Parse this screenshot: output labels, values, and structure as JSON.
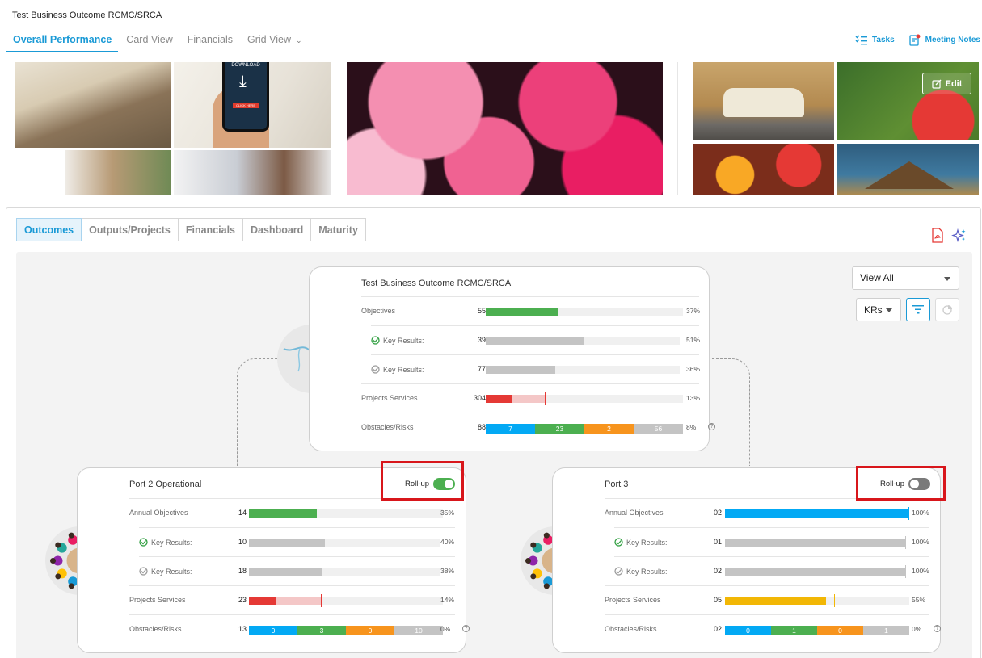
{
  "app": {
    "title": "Test Business Outcome RCMC/SRCA"
  },
  "top_tabs": [
    "Overall Performance",
    "Card View",
    "Financials",
    "Grid View"
  ],
  "header_actions": {
    "tasks": "Tasks",
    "meeting_notes": "Meeting Notes"
  },
  "banner": {
    "edit_label": "Edit",
    "phone_text": "DOWNLOAD",
    "phone_button": "CLICK HERE"
  },
  "sub_tabs": [
    "Outcomes",
    "Outputs/Projects",
    "Financials",
    "Dashboard",
    "Maturity"
  ],
  "controls": {
    "view_select": "View All",
    "kr_select": "KRs"
  },
  "colors": {
    "accent": "#1a9ad6",
    "green": "#4caf50",
    "red": "#e53935",
    "light_red": "#f4c7c7",
    "blue": "#03a9f4",
    "orange": "#f7941d",
    "gray": "#c4c4c4",
    "yellow": "#f2b705",
    "highlight": "#d8161b"
  },
  "cards": {
    "main": {
      "title": "Test Business Outcome RCMC/SRCA",
      "objectives": {
        "label": "Objectives",
        "count": "55",
        "percent": "37%",
        "value": 37
      },
      "kr_done": {
        "label": "Key Results:",
        "count": "39",
        "percent": "51%",
        "value": 51
      },
      "kr_pending": {
        "label": "Key Results:",
        "count": "77",
        "percent": "36%",
        "value": 36
      },
      "projects": {
        "label": "Projects Services",
        "count": "304",
        "percent": "13%",
        "value": 13,
        "light": 30
      },
      "obstacles": {
        "label": "Obstacles/Risks",
        "count": "88",
        "percent": "8%",
        "segments": [
          "7",
          "23",
          "2",
          "56"
        ]
      }
    },
    "port2": {
      "title": "Port 2 Operational",
      "rollup_label": "Roll-up",
      "rollup_on": true,
      "objectives": {
        "label": "Annual Objectives",
        "count": "14",
        "percent": "35%",
        "value": 35
      },
      "kr_done": {
        "label": "Key Results:",
        "count": "10",
        "percent": "40%",
        "value": 40
      },
      "kr_pending": {
        "label": "Key Results:",
        "count": "18",
        "percent": "38%",
        "value": 38
      },
      "projects": {
        "label": "Projects Services",
        "count": "23",
        "percent": "14%",
        "value": 14,
        "light": 37
      },
      "obstacles": {
        "label": "Obstacles/Risks",
        "count": "13",
        "percent": "0%",
        "segments": [
          "0",
          "3",
          "0",
          "10"
        ]
      }
    },
    "port3": {
      "title": "Port 3",
      "rollup_label": "Roll-up",
      "rollup_on": false,
      "objectives": {
        "label": "Annual Objectives",
        "count": "02",
        "percent": "100%",
        "value": 100
      },
      "kr_done": {
        "label": "Key Results:",
        "count": "01",
        "percent": "100%",
        "value": 100
      },
      "kr_pending": {
        "label": "Key Results:",
        "count": "02",
        "percent": "100%",
        "value": 100
      },
      "projects": {
        "label": "Projects Services",
        "count": "05",
        "percent": "55%",
        "value": 55
      },
      "obstacles": {
        "label": "Obstacles/Risks",
        "count": "02",
        "percent": "0%",
        "segments": [
          "0",
          "1",
          "0",
          "1"
        ]
      }
    }
  }
}
